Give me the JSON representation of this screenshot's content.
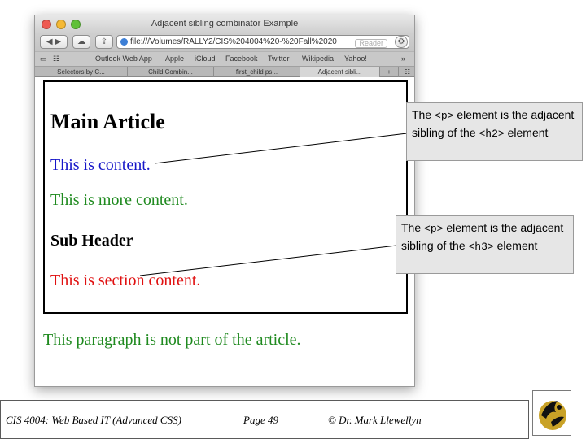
{
  "window": {
    "title": "Adjacent sibling combinator Example",
    "address": "file:///Volumes/RALLY2/CIS%204004%20-%20Fall%2020",
    "reader_label": "Reader"
  },
  "bookmarks": [
    "Outlook Web App",
    "Apple",
    "iCloud",
    "Facebook",
    "Twitter",
    "Wikipedia",
    "Yahoo!"
  ],
  "tabs": [
    {
      "label": "Selectors by C..."
    },
    {
      "label": "Child Combin..."
    },
    {
      "label": "first_child ps..."
    },
    {
      "label": "Adjacent sibli..."
    }
  ],
  "page": {
    "h2": "Main Article",
    "p1": "This is content.",
    "p2": "This is more content.",
    "h3": "Sub Header",
    "p3": "This is section content.",
    "outside": "This paragraph is not part of the article."
  },
  "callouts": {
    "c1": {
      "pre": "The",
      "code1": "<p>",
      "mid": "element is the adjacent sibling of the",
      "code2": "<h2>",
      "post": "element"
    },
    "c2": {
      "pre": "The",
      "code1": "<p>",
      "mid": "element is the adjacent sibling of the",
      "code2": "<h3>",
      "post": "element"
    }
  },
  "footer": {
    "course": "CIS 4004: Web Based IT (Advanced CSS)",
    "page": "Page 49",
    "author": "© Dr. Mark Llewellyn"
  },
  "colors": {
    "blue": "#1515c8",
    "green": "#1f8a1f",
    "red": "#e01010",
    "callout_bg": "#e6e6e6"
  }
}
